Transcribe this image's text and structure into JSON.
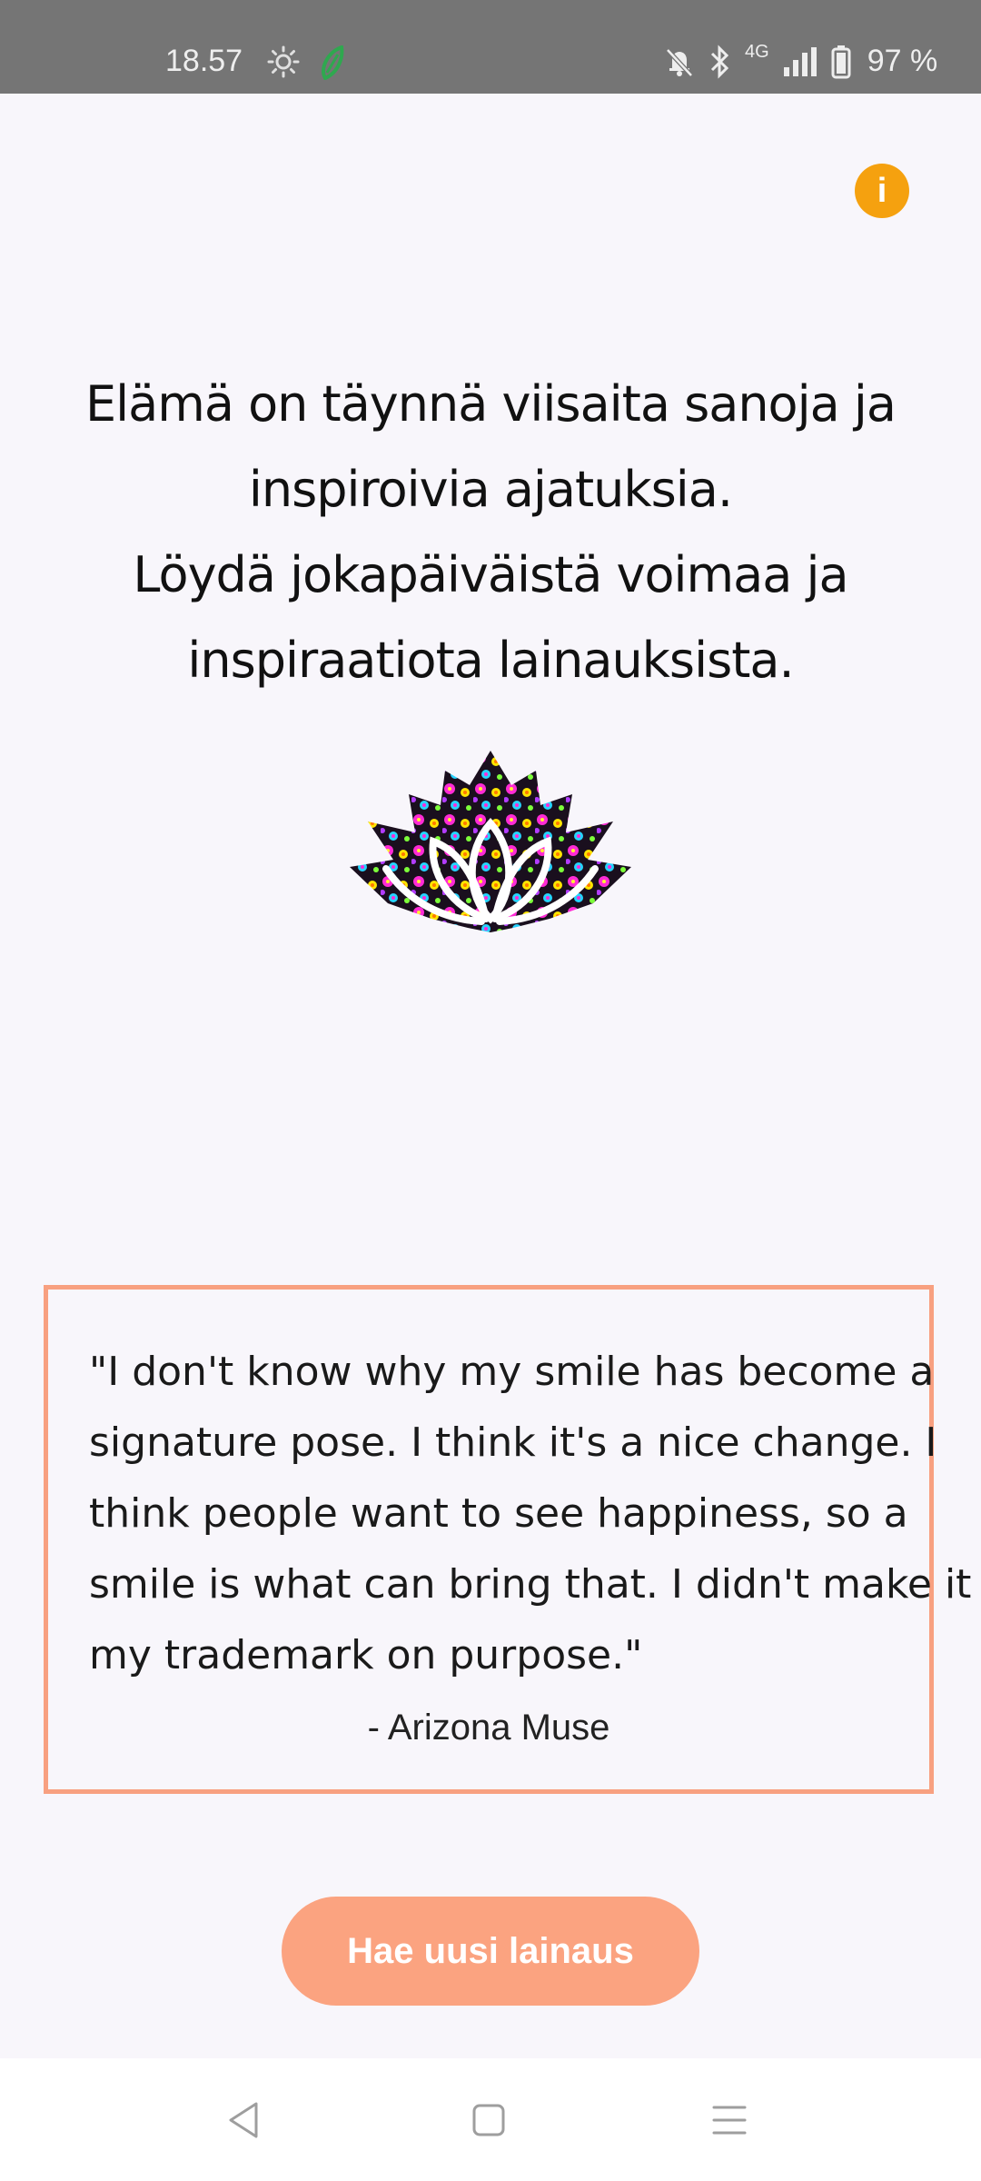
{
  "status_bar": {
    "time": "18.57",
    "network": "4G",
    "battery": "97 %",
    "icons": [
      "sun-icon",
      "leaf-icon",
      "mute-bell-icon",
      "bluetooth-icon",
      "signal-icon",
      "battery-icon"
    ]
  },
  "header": {
    "info_icon": "i"
  },
  "headline": {
    "line1": "Elämä on täynnä viisaita sanoja ja",
    "line2": "inspiroivia ajatuksia.",
    "line3": "Löydä jokapäiväistä voimaa ja",
    "line4": "inspiraatiota lainauksista."
  },
  "quote": {
    "line1": "\"I don't know why my smile has become a",
    "line2": "signature pose. I think it's a nice change. I",
    "line3": "think people want to see happiness, so a",
    "line4": "smile is what can bring that. I didn't make it",
    "line5": "my trademark on purpose.\"",
    "author": "- Arizona Muse"
  },
  "button": {
    "new_quote_label": "Hae uusi lainaus"
  },
  "colors": {
    "accent": "#fba380",
    "info": "#f5a10f",
    "background": "#f8f6fb",
    "status_bar": "#757575"
  },
  "nav": {
    "icons": [
      "back-icon",
      "home-icon",
      "recents-icon"
    ]
  }
}
